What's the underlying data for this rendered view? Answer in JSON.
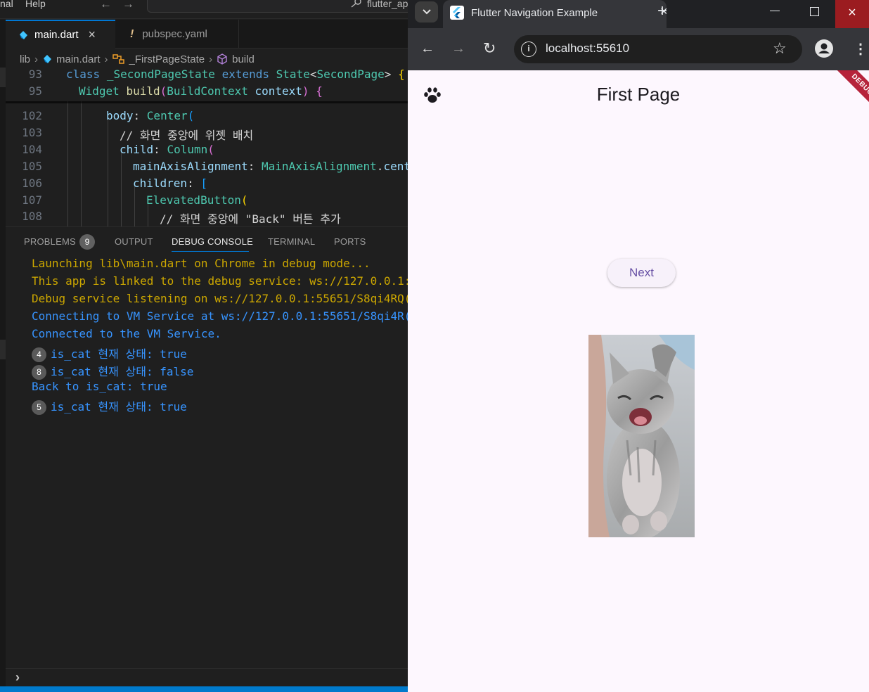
{
  "vscode": {
    "menu": [
      "nal",
      "Help"
    ],
    "command_center": "flutter_ap",
    "tabs": [
      {
        "label": "main.dart",
        "close": "×"
      },
      {
        "label": "pubspec.yaml",
        "icon_glyph": "!"
      }
    ],
    "breadcrumb": [
      "lib",
      "main.dart",
      "_FirstPageState",
      "build"
    ],
    "sticky_lines": [
      {
        "num": "93",
        "text": "class _SecondPageState extends State<SecondPage> {"
      },
      {
        "num": "95",
        "text": "Widget build(BuildContext context) {"
      }
    ],
    "lines": [
      {
        "num": "102",
        "text": "body: Center("
      },
      {
        "num": "103",
        "text": "// 화면 중앙에 위젯 배치"
      },
      {
        "num": "104",
        "text": "child: Column("
      },
      {
        "num": "105",
        "text": "mainAxisAlignment: MainAxisAlignment.cent"
      },
      {
        "num": "106",
        "text": "children: ["
      },
      {
        "num": "107",
        "text": "ElevatedButton("
      },
      {
        "num": "108",
        "text": "// 화면 중앙에 \"Back\" 버튼 추가"
      }
    ],
    "panel_tabs": [
      "PROBLEMS",
      "OUTPUT",
      "DEBUG CONSOLE",
      "TERMINAL",
      "PORTS"
    ],
    "problems_count": "9",
    "console": [
      {
        "text": "Launching lib\\main.dart on Chrome in debug mode...",
        "color": "#cca700"
      },
      {
        "text": "This app is linked to the debug service: ws://127.0.0.1:",
        "color": "#cca700"
      },
      {
        "text": "Debug service listening on ws://127.0.0.1:55651/S8qi4RQ(",
        "color": "#cca700"
      },
      {
        "text": "Connecting to VM Service at ws://127.0.0.1:55651/S8qi4R(",
        "color": "#3794ff"
      },
      {
        "text": "Connected to the VM Service.",
        "color": "#3794ff"
      },
      {
        "count": "4",
        "text": "is_cat 현재 상태: true",
        "color": "#3794ff"
      },
      {
        "count": "8",
        "text": "is_cat 현재 상태: false",
        "color": "#3794ff"
      },
      {
        "text": "Back to is_cat: true",
        "color": "#3794ff"
      },
      {
        "count": "5",
        "text": "is_cat 현재 상태: true",
        "color": "#3794ff"
      }
    ],
    "prompt_glyph": "›"
  },
  "chrome": {
    "tab_title": "Flutter Navigation Example",
    "tab_close": "×",
    "new_tab": "+",
    "url": "localhost:55610",
    "win_close": "×"
  },
  "flutter_page": {
    "title": "First Page",
    "appbar_icon": "paw-icon",
    "debug_banner": "DEBUG",
    "next_button": "Next",
    "image": "kitten-photo"
  },
  "colors": {
    "accent_blue": "#0078d4",
    "flutter_purple": "#6750a4",
    "page_bg": "#fdf7fe",
    "debug_red": "#b6233b"
  }
}
